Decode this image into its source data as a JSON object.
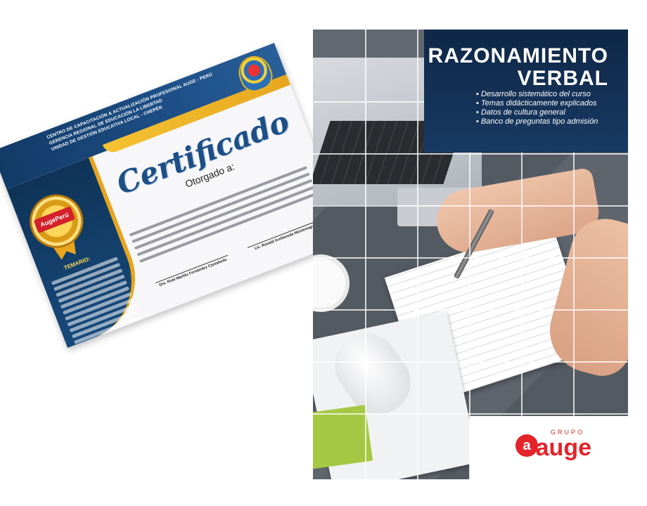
{
  "certificate": {
    "header_lines": [
      "CENTRO DE CAPACITACIÓN & ACTUALIZACIÓN PROFESIONAL AUGE - PERÚ",
      "GERENCIA REGIONAL DE EDUCACIÓN LA LIBERTAD",
      "UNIDAD DE GESTIÓN EDUCATIVA LOCAL - CHEPÉN"
    ],
    "medal_logo": "AugePerú",
    "title": "Certificado",
    "subtitle": "Otorgado a:",
    "temario_label": "TEMARIO:",
    "signatures": [
      "Dra. Rubí Marlitu Fernández Castañeda",
      "Lic. Ronald Arellaneda Montenegro"
    ]
  },
  "cover": {
    "title_line1": "RAZONAMIENTO",
    "title_line2": "VERBAL",
    "bullets": [
      "Desarrollo sistemático del curso",
      "Temas didácticamente explicados",
      "Datos de cultura general",
      "Banco de preguntas tipo admisión"
    ],
    "brand_grupo": "GRUPO",
    "brand_name": "auge",
    "brand_mark": "a"
  },
  "colors": {
    "navy": "#123a66",
    "gold": "#e6a51d",
    "brand_red": "#e3242b"
  }
}
